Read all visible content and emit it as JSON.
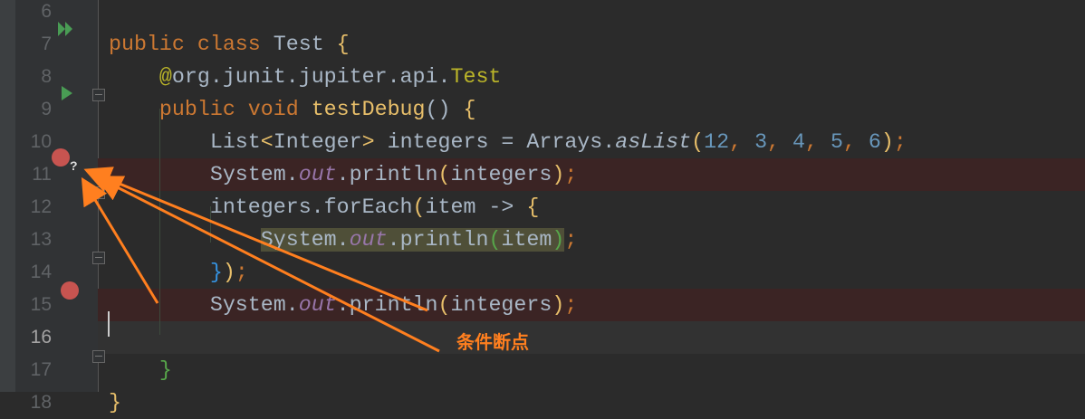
{
  "editor": {
    "lines": [
      {
        "n": "6",
        "tokens": []
      },
      {
        "n": "7",
        "tokens": [
          [
            "kw",
            "public class "
          ],
          [
            "",
            "Test "
          ],
          [
            "y",
            "{"
          ]
        ]
      },
      {
        "n": "8",
        "tokens": [
          [
            "",
            "    "
          ],
          [
            "an",
            "@"
          ],
          [
            "",
            "org.junit.jupiter.api."
          ],
          [
            "an",
            "Test"
          ]
        ]
      },
      {
        "n": "9",
        "tokens": [
          [
            "",
            "    "
          ],
          [
            "kw",
            "public void "
          ],
          [
            "y",
            "testDebug"
          ],
          [
            "",
            "() "
          ],
          [
            "y",
            "{"
          ]
        ]
      },
      {
        "n": "10",
        "tokens": [
          [
            "",
            "        List"
          ],
          [
            "y",
            "<"
          ],
          [
            "",
            "Integer"
          ],
          [
            "y",
            "> "
          ],
          [
            "",
            "integers = Arrays."
          ],
          [
            "it",
            "asList"
          ],
          [
            "y",
            "("
          ],
          [
            "num",
            "12"
          ],
          [
            "kw",
            ", "
          ],
          [
            "num",
            "3"
          ],
          [
            "kw",
            ", "
          ],
          [
            "num",
            "4"
          ],
          [
            "kw",
            ", "
          ],
          [
            "num",
            "5"
          ],
          [
            "kw",
            ", "
          ],
          [
            "num",
            "6"
          ],
          [
            "y",
            ")"
          ],
          [
            "kw",
            ";"
          ]
        ]
      },
      {
        "n": "11",
        "tokens": [
          [
            "",
            "        System."
          ],
          [
            "st",
            "out"
          ],
          [
            "",
            ".println"
          ],
          [
            "y",
            "("
          ],
          [
            "",
            "integers"
          ],
          [
            "y",
            ")"
          ],
          [
            "kw",
            ";"
          ]
        ]
      },
      {
        "n": "12",
        "tokens": [
          [
            "",
            "        integers.forEach"
          ],
          [
            "y",
            "("
          ],
          [
            "",
            "item -> "
          ],
          [
            "y",
            "{"
          ]
        ]
      },
      {
        "n": "13",
        "tokens": [
          [
            "",
            "            "
          ],
          [
            "hl",
            "System."
          ],
          [
            "hlst",
            "out"
          ],
          [
            "hl",
            ".println"
          ],
          [
            "hlg",
            "("
          ],
          [
            "hl",
            "item"
          ],
          [
            "hlg",
            ")"
          ],
          [
            "kw",
            ";"
          ]
        ]
      },
      {
        "n": "14",
        "tokens": [
          [
            "",
            "        "
          ],
          [
            "b",
            "}"
          ],
          [
            "y",
            ")"
          ],
          [
            "kw",
            ";"
          ]
        ]
      },
      {
        "n": "15",
        "tokens": [
          [
            "",
            "        System."
          ],
          [
            "st",
            "out"
          ],
          [
            "",
            ".println"
          ],
          [
            "y",
            "("
          ],
          [
            "",
            "integers"
          ],
          [
            "y",
            ")"
          ],
          [
            "kw",
            ";"
          ]
        ]
      },
      {
        "n": "16",
        "tokens": []
      },
      {
        "n": "17",
        "tokens": [
          [
            "",
            "    "
          ],
          [
            "g",
            "}"
          ]
        ]
      },
      {
        "n": "18",
        "tokens": [
          [
            "y",
            "}"
          ]
        ]
      }
    ],
    "conditional_marker": "?"
  },
  "annotation": {
    "label": "条件断点",
    "color": "#ff7f1f"
  }
}
